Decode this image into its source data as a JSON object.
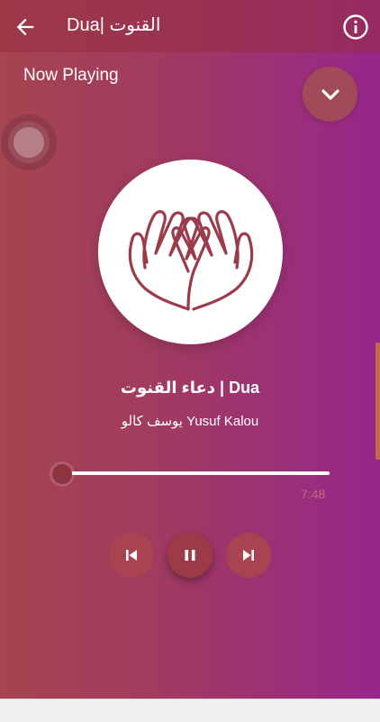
{
  "appbar": {
    "title": "Dua| القنوت",
    "back_icon": "arrow-left-icon",
    "info_icon": "info-circle-icon"
  },
  "player": {
    "section_label": "Now Playing",
    "collapse_icon": "chevron-down-icon",
    "artwork_icon": "praying-hands-icon",
    "track_title": "دعاء القنوت | Dua",
    "artist": "يوسف كالو Yusuf Kalou",
    "duration": "7:48",
    "progress": 0.0,
    "controls": {
      "previous_icon": "skip-previous-icon",
      "play_pause_icon": "pause-icon",
      "next_icon": "skip-next-icon"
    }
  },
  "colors": {
    "gradient_start": "#a5454f",
    "gradient_end": "#96278a",
    "accent": "#9d3a48",
    "artwork_stroke": "#9b3b4b"
  }
}
